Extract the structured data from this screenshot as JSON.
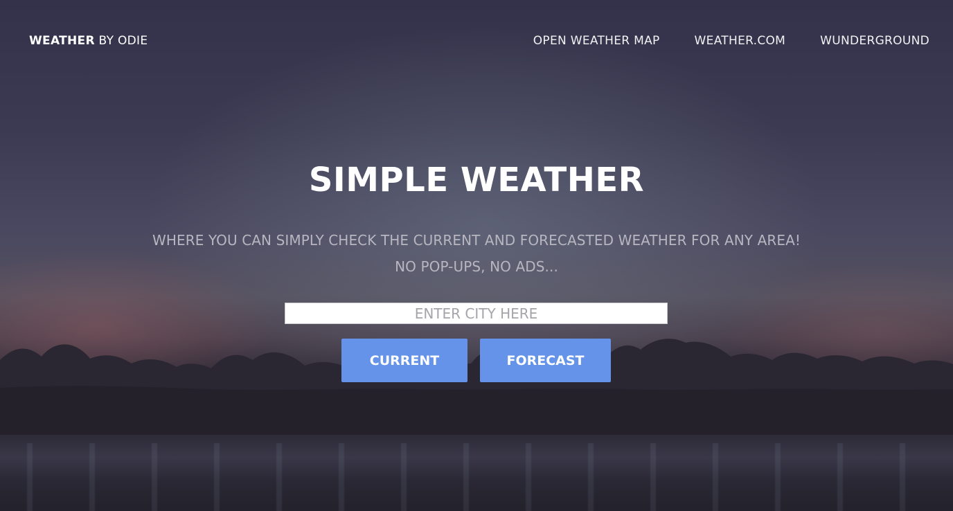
{
  "navbar": {
    "brand_bold": "WEATHER",
    "brand_rest": " BY ODIE",
    "links": [
      {
        "label": "OPEN WEATHER MAP"
      },
      {
        "label": "WEATHER.COM"
      },
      {
        "label": "WUNDERGROUND"
      }
    ]
  },
  "hero": {
    "title": "SIMPLE WEATHER",
    "subtitle_line1": "WHERE YOU CAN SIMPLY CHECK THE CURRENT AND FORECASTED WEATHER FOR ANY AREA!",
    "subtitle_line2": "NO POP-UPS, NO ADS..."
  },
  "search": {
    "placeholder": "ENTER CITY HERE",
    "value": ""
  },
  "buttons": {
    "current_label": "CURRENT",
    "forecast_label": "FORECAST"
  },
  "colors": {
    "button_bg": "#6493e9",
    "sky_top": "#34324a",
    "text_muted": "#b7b6c1"
  }
}
